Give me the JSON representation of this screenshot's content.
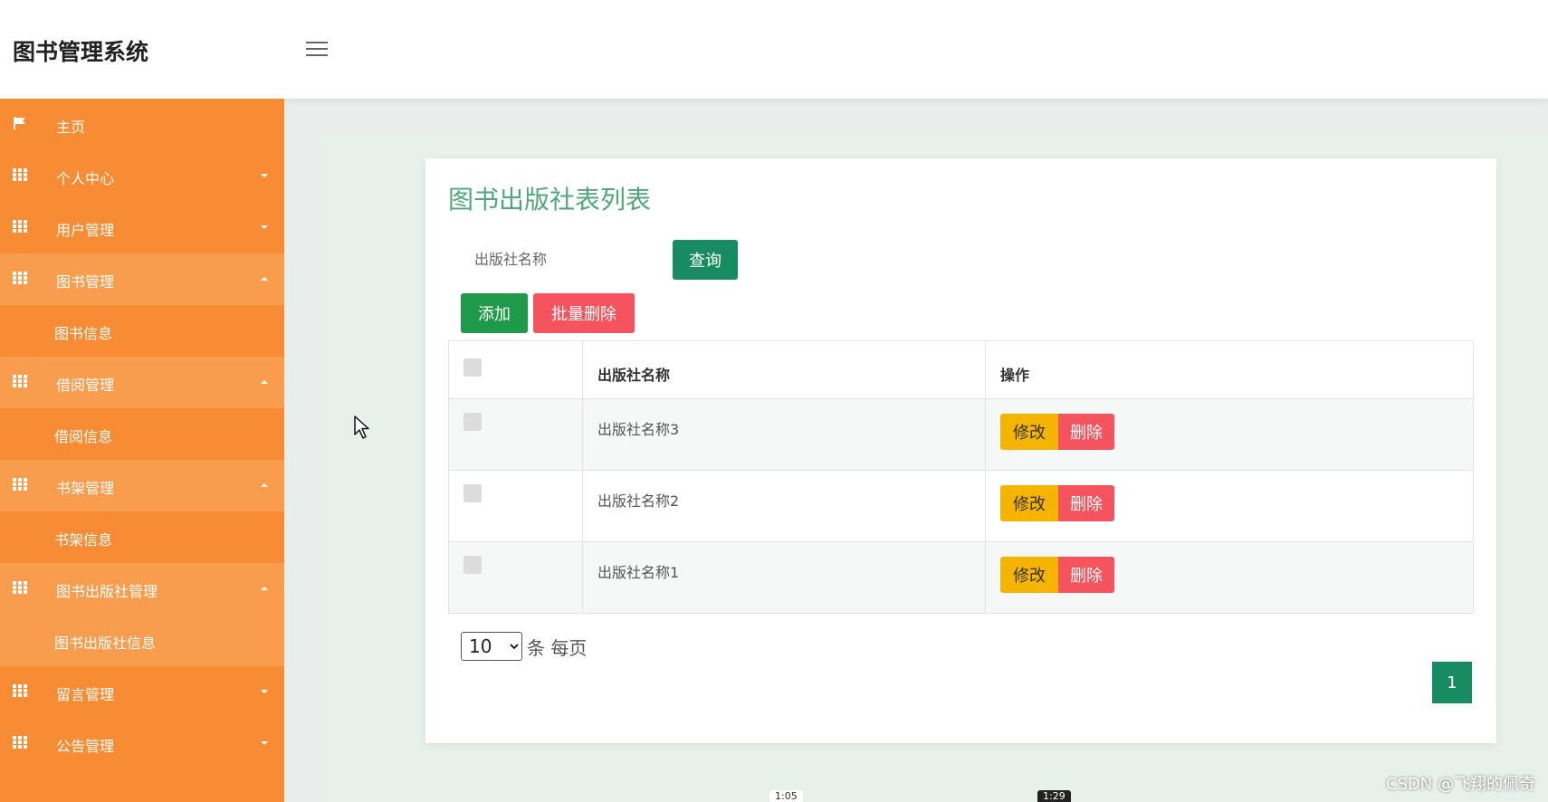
{
  "app": {
    "title": "图书管理系统"
  },
  "sidebar": {
    "items": [
      {
        "label": "主页",
        "icon": "flag-icon"
      },
      {
        "label": "个人中心",
        "icon": "grid-icon",
        "expanded": false
      },
      {
        "label": "用户管理",
        "icon": "grid-icon",
        "expanded": false
      },
      {
        "label": "图书管理",
        "icon": "grid-icon",
        "expanded": true,
        "sub": "图书信息"
      },
      {
        "label": "借阅管理",
        "icon": "grid-icon",
        "expanded": true,
        "sub": "借阅信息"
      },
      {
        "label": "书架管理",
        "icon": "grid-icon",
        "expanded": true,
        "sub": "书架信息"
      },
      {
        "label": "图书出版社管理",
        "icon": "grid-icon",
        "expanded": true,
        "sub": "图书出版社信息"
      },
      {
        "label": "留言管理",
        "icon": "grid-icon",
        "expanded": false
      },
      {
        "label": "公告管理",
        "icon": "grid-icon",
        "expanded": false
      }
    ]
  },
  "main": {
    "title": "图书出版社表列表",
    "search": {
      "placeholder": "出版社名称",
      "value": ""
    },
    "buttons": {
      "query": "查询",
      "add": "添加",
      "batch_delete": "批量删除"
    },
    "table": {
      "headers": [
        "",
        "出版社名称",
        "操作"
      ],
      "rows": [
        {
          "name": "出版社名称3"
        },
        {
          "name": "出版社名称2"
        },
        {
          "name": "出版社名称1"
        }
      ],
      "actions": {
        "edit": "修改",
        "delete": "删除"
      }
    },
    "pagination": {
      "page_size": "10",
      "page_size_options": [
        "10"
      ],
      "per_page_label": "条 每页",
      "current_page": "1"
    }
  },
  "overlay": {
    "watermark": "CSDN @飞翔的佩奇",
    "time_a": "1:05",
    "time_b": "1:29"
  },
  "colors": {
    "sidebar": "#f78c34",
    "accent": "#178b62",
    "title": "#4fa77e",
    "danger": "#f5535d",
    "warning": "#f4b400",
    "add": "#1e9a4a"
  }
}
